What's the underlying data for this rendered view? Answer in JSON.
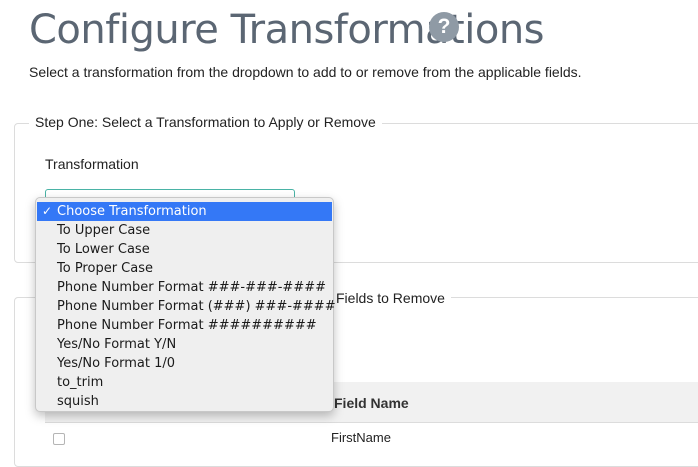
{
  "header": {
    "title": "Configure Transformations",
    "help_icon_glyph": "?",
    "subtitle": "Select a transformation from the dropdown to add to or remove from the applicable fields."
  },
  "step_one": {
    "legend": "Step One: Select a Transformation to Apply or Remove",
    "field_label": "Transformation"
  },
  "dropdown": {
    "check_glyph": "✓",
    "selected_index": 0,
    "options": [
      "Choose Transformation",
      "To Upper Case",
      "To Lower Case",
      "To Proper Case",
      "Phone Number Format ###-###-####",
      "Phone Number Format (###) ###-####",
      "Phone Number Format ##########",
      "Yes/No Format Y/N",
      "Yes/No Format 1/0",
      "to_trim",
      "squish"
    ]
  },
  "fields_to_remove": {
    "legend": "Fields to Remove",
    "column_header": "Field Name",
    "rows": [
      "FirstName"
    ]
  },
  "colors": {
    "selected_bg": "#3478f6",
    "select_border": "#4ab3a6",
    "title_color": "#5b6673"
  }
}
